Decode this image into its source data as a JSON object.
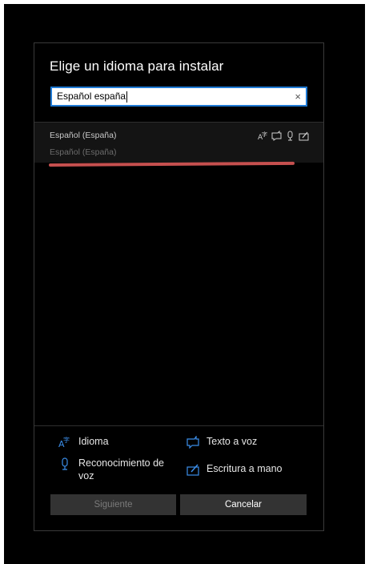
{
  "dialog": {
    "title": "Elige un idioma para instalar",
    "search": {
      "value": "Español españa",
      "clear_symbol": "×"
    },
    "results": [
      {
        "name": "Español (España)",
        "native_name": "Español (España)",
        "features": [
          "language-pack-icon",
          "text-to-speech-icon",
          "speech-recognition-icon",
          "handwriting-icon"
        ]
      }
    ],
    "legend": {
      "language": "Idioma",
      "text_to_speech": "Texto a voz",
      "speech_recognition": "Reconocimiento de voz",
      "handwriting": "Escritura a mano"
    },
    "buttons": {
      "next": "Siguiente",
      "cancel": "Cancelar"
    },
    "colors": {
      "accent": "#1f7ad4",
      "icon_blue": "#3b8eea",
      "annotation_red": "#c6504f"
    }
  }
}
